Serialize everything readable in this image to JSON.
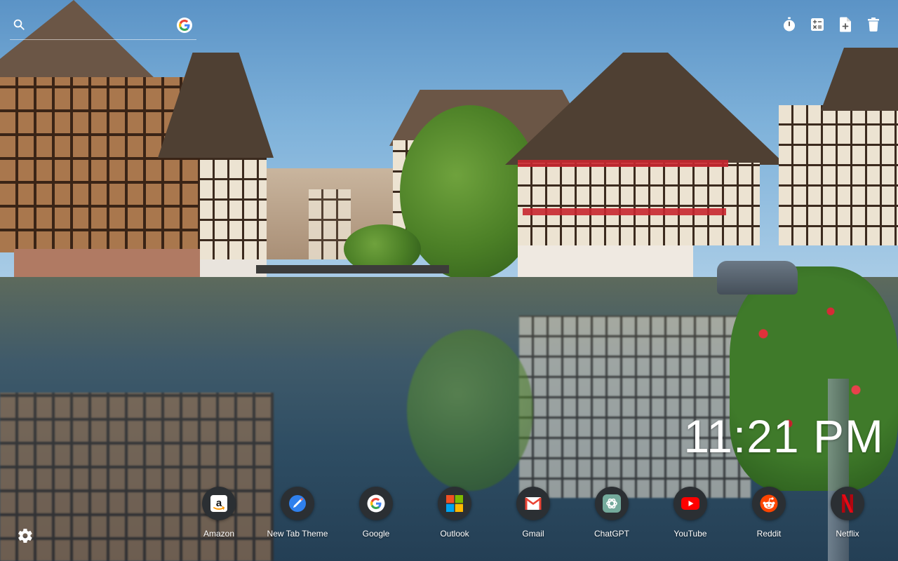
{
  "search": {
    "placeholder": "",
    "icon": "search-icon",
    "engine_icon": "google-icon"
  },
  "tools": [
    {
      "id": "timer",
      "icon": "stopwatch-icon"
    },
    {
      "id": "calculator",
      "icon": "calculator-icon"
    },
    {
      "id": "notes",
      "icon": "note-add-icon"
    },
    {
      "id": "trash",
      "icon": "trash-icon"
    }
  ],
  "clock": {
    "time": "11:21 PM"
  },
  "shortcuts": [
    {
      "label": "Amazon",
      "icon": "amazon-icon"
    },
    {
      "label": "New Tab Theme",
      "icon": "new-tab-theme-icon"
    },
    {
      "label": "Google",
      "icon": "google-icon"
    },
    {
      "label": "Outlook",
      "icon": "outlook-icon"
    },
    {
      "label": "Gmail",
      "icon": "gmail-icon"
    },
    {
      "label": "ChatGPT",
      "icon": "chatgpt-icon"
    },
    {
      "label": "YouTube",
      "icon": "youtube-icon"
    },
    {
      "label": "Reddit",
      "icon": "reddit-icon"
    },
    {
      "label": "Netflix",
      "icon": "netflix-icon"
    }
  ],
  "settings": {
    "icon": "gear-icon"
  },
  "colors": {
    "dock_circle": "#2b2f33",
    "google_blue": "#4285F4",
    "google_red": "#EA4335",
    "google_yellow": "#FBBC05",
    "google_green": "#34A853",
    "youtube_red": "#FF0000",
    "reddit_orange": "#FF4500",
    "netflix_red": "#E50914",
    "chatgpt_teal": "#74AA9C"
  }
}
